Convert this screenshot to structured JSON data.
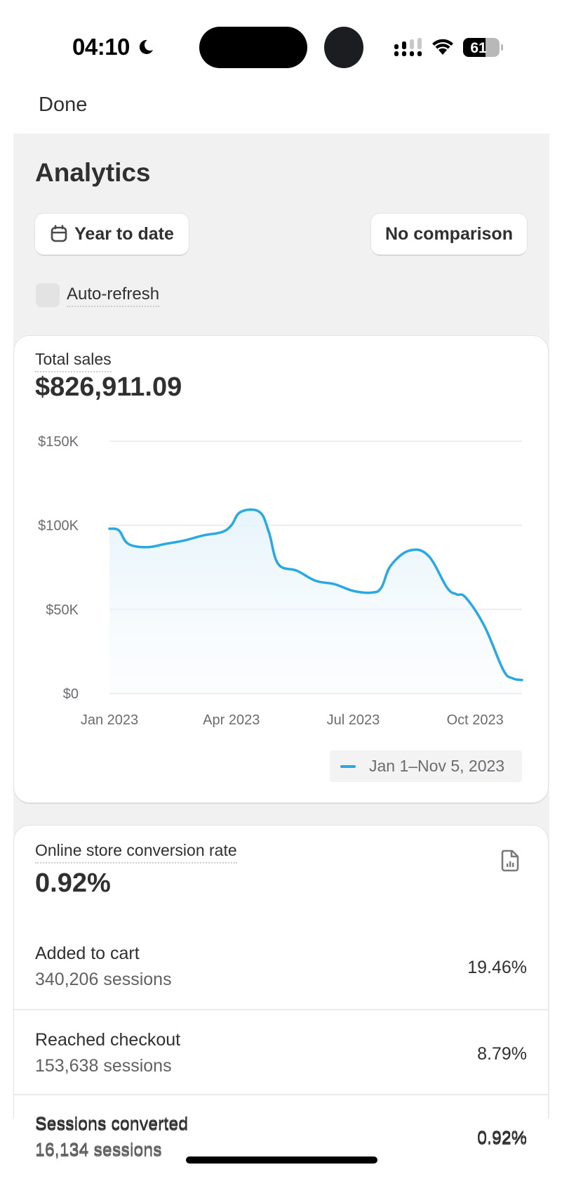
{
  "status_bar": {
    "time": "04:10",
    "focus_icon": "moon-icon",
    "battery_level": "61",
    "signal_icon": "cellular-signal-icon",
    "wifi_icon": "wifi-icon"
  },
  "nav": {
    "done_label": "Done"
  },
  "page": {
    "title": "Analytics",
    "date_range_button": {
      "icon": "calendar-icon",
      "label": "Year to date"
    },
    "comparison_button": {
      "label": "No comparison"
    },
    "auto_refresh": {
      "label": "Auto-refresh",
      "checked": false
    }
  },
  "total_sales": {
    "label": "Total sales",
    "value": "$826,911.09",
    "legend_label": "Jan 1–Nov 5, 2023",
    "line_color": "#29a9e1"
  },
  "chart_data": {
    "type": "area",
    "title": "Total sales",
    "xlabel": "",
    "ylabel": "",
    "x_ticks": [
      "Jan 2023",
      "Apr 2023",
      "Jul 2023",
      "Oct 2023"
    ],
    "x_tick_weeks": [
      0,
      13,
      26,
      39
    ],
    "y_ticks": [
      "$0",
      "$50K",
      "$100K",
      "$150K"
    ],
    "y_tick_values": [
      0,
      50000,
      100000,
      150000
    ],
    "ylim": [
      0,
      150000
    ],
    "x_range_weeks": [
      0,
      44
    ],
    "grid": true,
    "legend": "bottom-right",
    "series": [
      {
        "name": "Jan 1–Nov 5, 2023",
        "x_weeks": [
          0,
          1,
          2,
          4,
          6,
          8,
          10,
          12,
          13,
          14,
          16,
          17,
          18,
          20,
          22,
          24,
          26,
          28,
          29,
          30,
          32,
          34,
          36,
          37,
          38,
          40,
          42,
          43,
          44
        ],
        "values": [
          98000,
          97000,
          89000,
          87000,
          89000,
          91000,
          94000,
          96000,
          100000,
          108000,
          108000,
          96000,
          77000,
          73000,
          67000,
          65000,
          61000,
          60000,
          63000,
          76000,
          85000,
          82000,
          63000,
          59000,
          57000,
          40000,
          14000,
          9000,
          8000
        ]
      }
    ]
  },
  "conversion": {
    "label": "Online store conversion rate",
    "value": "0.92%",
    "report_icon": "report-icon",
    "rows": [
      {
        "title": "Added to cart",
        "sessions": "340,206 sessions",
        "percent": "19.46%"
      },
      {
        "title": "Reached checkout",
        "sessions": "153,638 sessions",
        "percent": "8.79%"
      },
      {
        "title": "Sessions converted",
        "sessions": "16,134 sessions",
        "percent": "0.92%"
      }
    ]
  }
}
